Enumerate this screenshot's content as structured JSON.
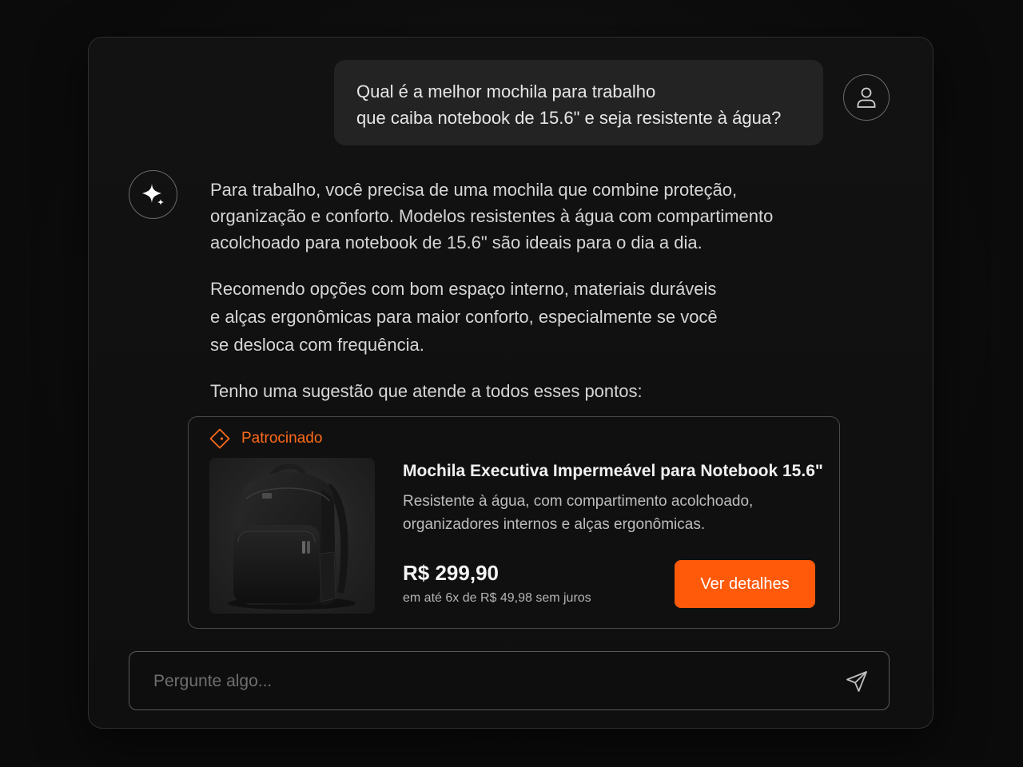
{
  "conversation": {
    "user_message": {
      "lines": [
        "Qual é a melhor mochila para trabalho",
        "que caiba notebook de 15.6\" e seja resistente à água?"
      ],
      "avatar_icon": "user-icon"
    },
    "assistant_message": {
      "avatar_icon": "sparkle-icon",
      "paragraphs": [
        {
          "lines": [
            "Para trabalho, você precisa de uma mochila que combine proteção,",
            "organização e conforto. Modelos resistentes à água com compartimento",
            "acolchoado para notebook de 15.6\" são ideais para o dia a dia."
          ]
        },
        {
          "lines": [
            "Recomendo opções com bom espaço interno, materiais duráveis",
            "e alças ergonômicas para maior conforto, especialmente se você",
            "se desloca com frequência."
          ]
        },
        {
          "lines": [
            "Tenho uma sugestão que atende a todos esses pontos:"
          ]
        }
      ]
    }
  },
  "product_card": {
    "sponsored_label": "Patrocinado",
    "sponsored_icon": "tag-icon",
    "image_icon": "backpack-image",
    "title": "Mochila Executiva Impermeável para Notebook 15.6\"",
    "description_lines": [
      "Resistente à água, com compartimento acolchoado,",
      "organizadores internos e alças ergonômicas."
    ],
    "price": "R$ 299,90",
    "installments": "em até 6x de R$ 49,98 sem juros",
    "button_label": "Ver detalhes"
  },
  "input": {
    "placeholder": "Pergunte algo...",
    "value": "",
    "send_icon": "send-icon"
  },
  "colors": {
    "accent": "#ff5a0a",
    "sponsored": "#ff6a1a",
    "background": "#0b0b0b",
    "panel": "#121212",
    "bubble": "#232323"
  }
}
